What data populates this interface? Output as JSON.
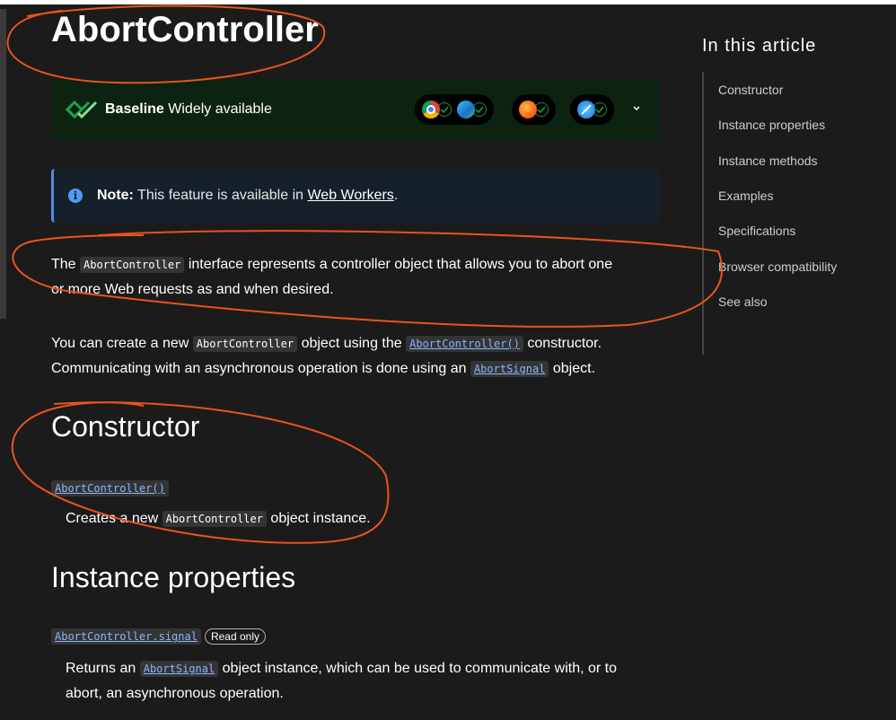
{
  "page": {
    "title": "AbortController"
  },
  "baseline": {
    "label_bold": "Baseline",
    "label_rest": " Widely available",
    "browsers": [
      "chrome-icon",
      "edge-icon",
      "firefox-icon",
      "safari-icon"
    ]
  },
  "note": {
    "prefix": "Note:",
    "text": " This feature is available in ",
    "link": "Web Workers",
    "suffix": "."
  },
  "intro": {
    "p1_a": "The ",
    "p1_code": "AbortController",
    "p1_b": " interface represents a controller object that allows you to abort one",
    "p1_c": "or more Web requests as and when desired.",
    "p2_a": "You can create a new ",
    "p2_code1": "AbortController",
    "p2_b": " object using the ",
    "p2_code2": "AbortController()",
    "p2_c": " constructor.",
    "p2_d": "Communicating with an asynchronous operation is done using an ",
    "p2_code3": "AbortSignal",
    "p2_e": " object."
  },
  "constructor": {
    "heading": "Constructor",
    "term": "AbortController()",
    "desc_a": "Creates a new ",
    "desc_code": "AbortController",
    "desc_b": " object instance."
  },
  "properties": {
    "heading": "Instance properties",
    "term": "AbortController.signal",
    "badge": "Read only",
    "desc_a": "Returns an ",
    "desc_code": "AbortSignal",
    "desc_b": " object instance, which can be used to communicate with, or to",
    "desc_c": "abort, an asynchronous operation."
  },
  "toc": {
    "title": "In this article",
    "items": [
      "Constructor",
      "Instance properties",
      "Instance methods",
      "Examples",
      "Specifications",
      "Browser compatibility",
      "See also"
    ]
  },
  "colors": {
    "background": "#1b1b1b",
    "baseline_bg": "#0c2311",
    "note_bg": "#15202b",
    "link": "#8cb4ff",
    "annotation": "#e8541c"
  }
}
